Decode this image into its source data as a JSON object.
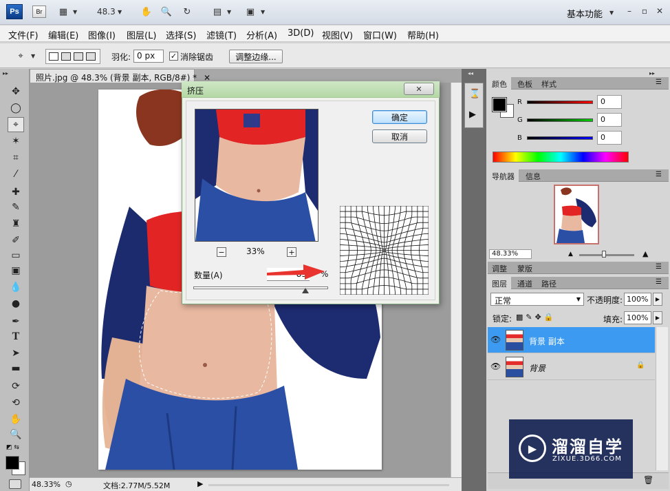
{
  "app": {
    "logo": "Ps",
    "bridge": "Br",
    "zoom": "48.3",
    "workspace": "基本功能"
  },
  "menu": [
    "文件(F)",
    "编辑(E)",
    "图像(I)",
    "图层(L)",
    "选择(S)",
    "滤镜(T)",
    "分析(A)",
    "3D(D)",
    "视图(V)",
    "窗口(W)",
    "帮助(H)"
  ],
  "options": {
    "feather_label": "羽化:",
    "feather_value": "0 px",
    "antialias_label": "消除锯齿",
    "antialias_checked": true,
    "refine_edge": "调整边缘..."
  },
  "document": {
    "tab_title": "照片.jpg @ 48.3% (背景 副本, RGB/8#) *",
    "zoom_status": "48.33%",
    "doc_size": "文档:2.77M/5.52M"
  },
  "dialog": {
    "title": "挤压",
    "ok": "确定",
    "cancel": "取消",
    "preview_zoom": "33%",
    "amount_label": "数量(A)",
    "amount_value": "83",
    "amount_unit": "%",
    "amount_slider": 0.83
  },
  "color_panel": {
    "tabs": [
      "颜色",
      "色板",
      "样式"
    ],
    "channels": [
      {
        "label": "R",
        "value": "0"
      },
      {
        "label": "G",
        "value": "0"
      },
      {
        "label": "B",
        "value": "0"
      }
    ]
  },
  "navigator_panel": {
    "tabs": [
      "导航器",
      "信息"
    ],
    "zoom": "48.33%"
  },
  "adjust_panel": {
    "tabs": [
      "调整",
      "蒙版"
    ]
  },
  "layers_panel": {
    "tabs": [
      "图层",
      "通道",
      "路径"
    ],
    "blend_mode": "正常",
    "opacity_label": "不透明度:",
    "opacity_value": "100%",
    "lock_label": "锁定:",
    "fill_label": "填充:",
    "fill_value": "100%",
    "layers": [
      {
        "name": "背景 副本",
        "selected": true
      },
      {
        "name": "背景",
        "selected": false
      }
    ]
  },
  "watermark": {
    "title": "溜溜自学",
    "url": "ZIXUE.3D66.COM"
  }
}
